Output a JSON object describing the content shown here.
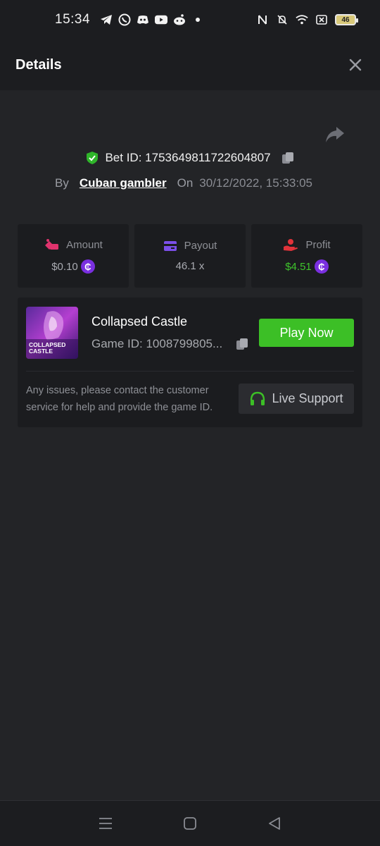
{
  "status_bar": {
    "time": "15:34",
    "battery": "46",
    "left_icons": [
      "telegram-icon",
      "whatsapp-icon",
      "discord-icon",
      "youtube-icon",
      "reddit-icon",
      "dot-icon"
    ],
    "right_icons": [
      "nfc-icon",
      "bell-muted-icon",
      "wifi-icon",
      "close-box-icon",
      "battery-icon"
    ]
  },
  "header": {
    "title": "Details"
  },
  "bet": {
    "label": "Bet ID: 1753649811722604807",
    "by_label": "By",
    "user": "Cuban gambler",
    "on_label": "On",
    "date": "30/12/2022, 15:33:05"
  },
  "stats": {
    "amount": {
      "label": "Amount",
      "value": "$0.10"
    },
    "payout": {
      "label": "Payout",
      "value": "46.1 x"
    },
    "profit": {
      "label": "Profit",
      "value": "$4.51"
    }
  },
  "game": {
    "name": "Collapsed Castle",
    "id": "Game ID: 1008799805...",
    "thumb_text": "COLLAPSED CASTLE",
    "play_label": "Play Now",
    "notice": "Any issues, please contact the customer service for help and provide the game ID.",
    "support_label": "Live Support"
  },
  "colors": {
    "accent_green": "#3cbf26",
    "profit_green": "#3fc32c",
    "coin_purple": "#7a2fe0",
    "amount_pink": "#e0336d",
    "payout_purple": "#7b4fe8",
    "profit_red": "#e0333a"
  }
}
